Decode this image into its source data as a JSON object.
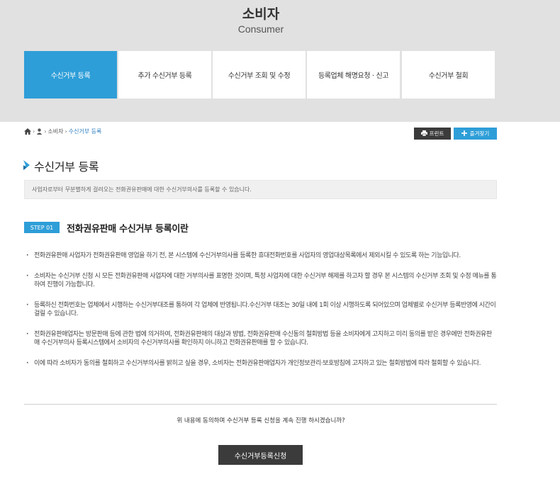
{
  "header": {
    "title": "소비자",
    "subtitle": "Consumer"
  },
  "tabs": [
    {
      "label": "수신거부 등록",
      "active": true
    },
    {
      "label": "추가 수신거부 등록",
      "active": false
    },
    {
      "label": "수신거부 조회 및 수정",
      "active": false
    },
    {
      "label": "등록업체 해명요청 · 신고",
      "active": false
    },
    {
      "label": "수신거부 철회",
      "active": false
    }
  ],
  "breadcrumb": {
    "item1": "소비자",
    "item2": "수신거부 등록",
    "sep": "›"
  },
  "toolbar": {
    "print_label": "프린트",
    "favorite_label": "즐겨찾기"
  },
  "section": {
    "title": "수신거부 등록",
    "description": "사업자로부터 무분별하게 걸려오는 전화권유판매에 대한 수신거부의사를 등록할 수 있습니다."
  },
  "step": {
    "badge": "STEP 01",
    "title": "전화권유판매 수신거부 등록이란",
    "bullets": [
      "전화권유판매 사업자가 전화권유판매 영업을 하기 전, 본 시스템에 수신거부의사를 등록한 휴대전화번호를 사업자의 영업대상목록에서 제외시킬 수 있도록 하는 기능입니다.",
      "소비자는 수신거부 신청 시 모든 전화권유판매 사업자에 대한 거부의사를 표명한 것이며, 특정 사업자에 대한 수신거부 해제를 하고자 할 경우 본 시스템의 수신거부 조회 및 수정 메뉴를 통하여 진행이 가능합니다.",
      "등록하신 전화번호는 업체에서 시행하는 수신거부대조를 통하여 각 업체에 반영됩니다.수신거부 대조는 30일 내에 1회 이상 시행하도록 되어있으며 업체별로 수신거부 등록반영에 시간이 걸릴 수 있습니다.",
      "전화권유판매업자는 방문판매 등에 관한 법에 의거하여, 전화권유판매의 대상과 방법, 전화권유판매 수신동의 철회방법 등을 소비자에게 고지하고 미리 동의를 받은 경우에만 전화권유판매 수신거부의사 등록시스템에서 소비자의 수신거부의사를 확인하지 아니하고 전화권유판매를 할 수 있습니다.",
      "이에 따라 소비자가 동의를 철회하고 수신거부의사를 밝히고 싶을 경우, 소비자는 전화권유판매업자가 개인정보관리·보호방침에 고지하고 있는 철회방법에 따라 철회할 수 있습니다."
    ]
  },
  "confirm_text": "위 내용에 동의하며 수신거부 등록 신청을 계속 진행 하시겠습니까?",
  "submit_label": "수신거부등록신청",
  "colors": {
    "accent": "#2e9ed8",
    "dark_button": "#3b3b3b",
    "header_bg": "#e1e1e1"
  }
}
